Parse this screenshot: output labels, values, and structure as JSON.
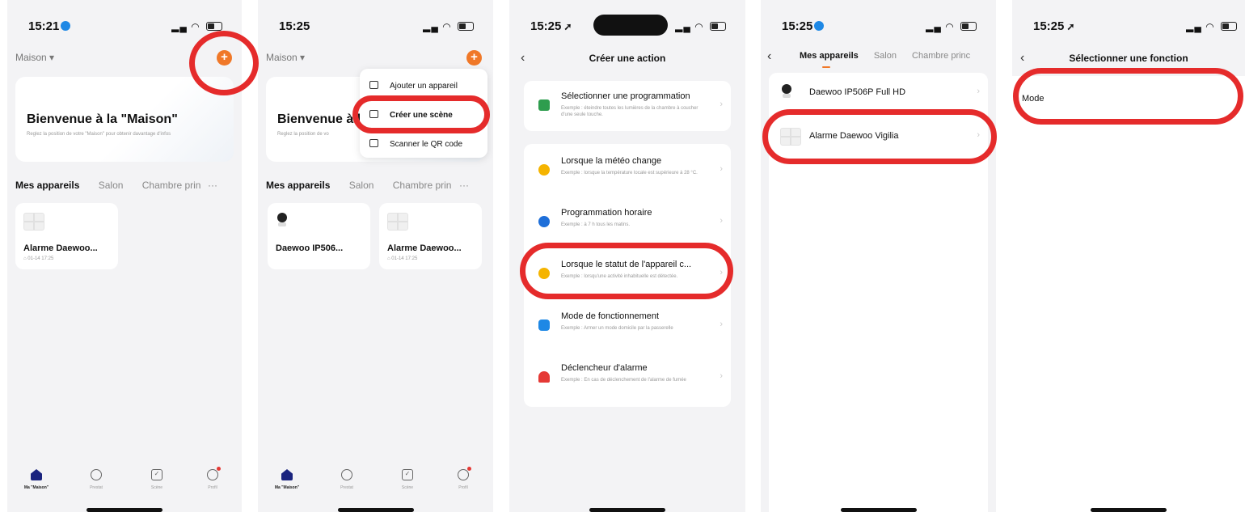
{
  "screen1": {
    "time": "15:21",
    "home_selector": "Maison ▾",
    "welcome_title": "Bienvenue à la \"Maison\"",
    "welcome_subtitle": "Reglez la position de votre \"Maison\" pour obtenir davantage d'infos",
    "tabs": [
      "Mes appareils",
      "Salon",
      "Chambre prin"
    ],
    "more": "···",
    "devices": [
      {
        "name": "Alarme Daewoo...",
        "sub": "⌂ 01-14 17:25"
      }
    ],
    "tabbar": [
      "Ma \"Maison\"",
      "Prestat",
      "Scène",
      "Profil"
    ]
  },
  "screen2": {
    "time": "15:25",
    "home_selector": "Maison ▾",
    "welcome_title": "Bienvenue à l",
    "welcome_subtitle": "Reglez la position de vo",
    "menu": [
      "Ajouter un appareil",
      "Créer une scène",
      "Scanner le QR code"
    ],
    "tabs": [
      "Mes appareils",
      "Salon",
      "Chambre prin"
    ],
    "more": "···",
    "devices": [
      {
        "name": "Daewoo IP506...",
        "sub": ""
      },
      {
        "name": "Alarme Daewoo...",
        "sub": "⌂ 01-14 17:25"
      }
    ],
    "tabbar": [
      "Ma \"Maison\"",
      "Prestat",
      "Scène",
      "Profil"
    ]
  },
  "screen3": {
    "time": "15:25",
    "title": "Créer une action",
    "rows": [
      {
        "title": "Sélectionner une programmation",
        "sub": "Exemple : éteindre toutes les lumières de la chambre à coucher d'une seule touche.",
        "color": "#2e9d4e"
      },
      {
        "title": "Lorsque la météo change",
        "sub": "Exemple : lorsque la température locale est supérieure à 28 °C.",
        "color": "#f5b400"
      },
      {
        "title": "Programmation horaire",
        "sub": "Exemple : à 7 h tous les matins.",
        "color": "#1e6fd9"
      },
      {
        "title": "Lorsque le statut de l'appareil c...",
        "sub": "Exemple : lorsqu'une activité inhabituelle est détectée.",
        "color": "#f5b400"
      },
      {
        "title": "Mode de fonctionnement",
        "sub": "Exemple : Armer un mode domicile par la passerelle",
        "color": "#1e88e5"
      },
      {
        "title": "Déclencheur d'alarme",
        "sub": "Exemple : En cas de déclenchement de l'alarme de fumée",
        "color": "#e53935"
      }
    ]
  },
  "screen4": {
    "time": "15:25",
    "tabs": [
      "Mes appareils",
      "Salon",
      "Chambre princ"
    ],
    "devices": [
      "Daewoo IP506P Full HD",
      "Alarme Daewoo Vigilia"
    ]
  },
  "screen5": {
    "time": "15:25",
    "title": "Sélectionner une fonction",
    "item": "Mode"
  },
  "colors": {
    "accent": "#f07828",
    "highlight_ring": "#e52b2b",
    "active_tab_icon": "#1a237e"
  }
}
